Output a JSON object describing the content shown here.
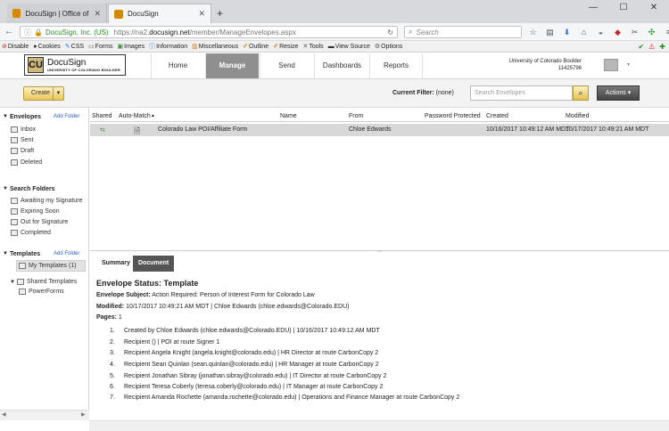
{
  "browser": {
    "tabs": [
      {
        "label": "DocuSign | Office of Informa",
        "active": false
      },
      {
        "label": "DocuSign",
        "active": true
      }
    ],
    "new_tab": "+",
    "window_controls": [
      "—",
      "☐",
      "✕"
    ],
    "site_identity": "DocuSign, Inc. (US)",
    "url_prefix": "https://na2.",
    "url_domain": "docusign.net",
    "url_path": "/member/ManageEnvelopes.aspx",
    "search_placeholder": "Search"
  },
  "devbar": {
    "items": [
      "Disable",
      "Cookies",
      "CSS",
      "Forms",
      "Images",
      "Information",
      "Miscellaneous",
      "Outline",
      "Resize",
      "Tools",
      "View Source",
      "Options"
    ]
  },
  "app": {
    "logo_text": "DocuSign",
    "logo_sub": "UNIVERSITY OF COLORADO BOULDER",
    "logo_mark": "CU",
    "nav": [
      "Home",
      "Manage",
      "Send",
      "Dashboards",
      "Reports"
    ],
    "active_nav": "Manage",
    "account_name": "University of Colorado Boulder",
    "account_id": "11425796"
  },
  "toolbar": {
    "create_label": "Create",
    "filter_label": "Current Filter:",
    "filter_value": "(none)",
    "search_placeholder": "Search Envelopes",
    "actions_label": "Actions"
  },
  "sidebar": {
    "envelopes_header": "Envelopes",
    "add_folder": "Add Folder",
    "envelopes": [
      "Inbox",
      "Sent",
      "Draft",
      "Deleted"
    ],
    "search_header": "Search Folders",
    "search_folders": [
      "Awaiting my Signature",
      "Expiring Soon",
      "Out for Signature",
      "Completed"
    ],
    "templates_header": "Templates",
    "templates_add": "Add Folder",
    "my_templates": "My Templates (1)",
    "shared_templates": "Shared Templates",
    "powerforms": "PowerForms"
  },
  "list": {
    "columns": [
      "Shared",
      "Auto-Match",
      "Name",
      "From",
      "Password Protected",
      "Created",
      "Modified"
    ],
    "rows": [
      {
        "name": "Colorado Law POI/Affiliate Form",
        "from": "Chloe Edwards",
        "created": "10/16/2017 10:49:12 AM MDT",
        "modified": "10/17/2017 10:49:21 AM MDT"
      }
    ]
  },
  "detail": {
    "tabs": [
      "Summary",
      "Document"
    ],
    "status": "Envelope Status: Template",
    "subject_label": "Envelope Subject:",
    "subject": "Action Required: Person of Interest Form for Colorado Law",
    "modified_label": "Modified:",
    "modified": "10/17/2017 10:49:21 AM MDT | Chloe Edwards (chloe.edwards@Colorado.EDU)",
    "pages_label": "Pages:",
    "pages": "1",
    "history": [
      {
        "n": "1.",
        "text": "Created by Chloe Edwards (chloe.edwards@Colorado.EDU) | 10/16/2017 10:49:12 AM MDT"
      },
      {
        "n": "2.",
        "text": "Recipient () | POI at route Signer 1"
      },
      {
        "n": "3.",
        "text": "Recipient Angela Knight (angela.knight@colorado.edu) | HR Director at route CarbonCopy 2"
      },
      {
        "n": "4.",
        "text": "Recipient Sean Quinlan (sean.quinlan@colorado.edu) | HR Manager at route CarbonCopy 2"
      },
      {
        "n": "5.",
        "text": "Recipient Jonathan Sibray (jonathan.sibray@colorado.edu) | IT Director at route CarbonCopy 2"
      },
      {
        "n": "6.",
        "text": "Recipient Teresa Coberly (teresa.coberly@colorado.edu) | IT Manager at route CarbonCopy 2"
      },
      {
        "n": "7.",
        "text": "Recipient Amanda Rochette (amanda.rochette@colorado.edu) | Operations and Finance Manager at route CarbonCopy 2"
      }
    ]
  }
}
